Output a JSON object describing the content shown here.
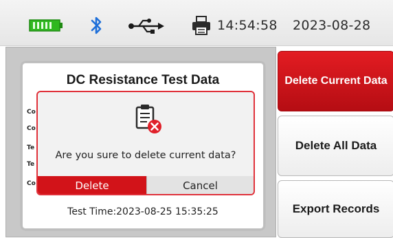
{
  "status_bar": {
    "time": "14:54:58",
    "date": "2023-08-28",
    "icons": [
      "battery-icon",
      "bluetooth-icon",
      "usb-icon",
      "printer-icon"
    ]
  },
  "panel": {
    "title": "DC Resistance Test Data",
    "row_stubs": [
      "Co",
      "Co",
      "Te",
      "Te",
      "Co"
    ],
    "test_time": "Test Time:2023-08-25  15:35:25"
  },
  "dialog": {
    "icon": "delete-document-icon",
    "message": "Are you sure to delete current data?",
    "delete_label": "Delete",
    "cancel_label": "Cancel"
  },
  "side_buttons": [
    {
      "label": "Delete Current Data",
      "active": true
    },
    {
      "label": "Delete All Data",
      "active": false
    },
    {
      "label": "Export Records",
      "active": false
    }
  ],
  "colors": {
    "accent_red": "#d21319",
    "battery_green": "#2fb81f",
    "bluetooth_blue": "#1e6fd9"
  }
}
